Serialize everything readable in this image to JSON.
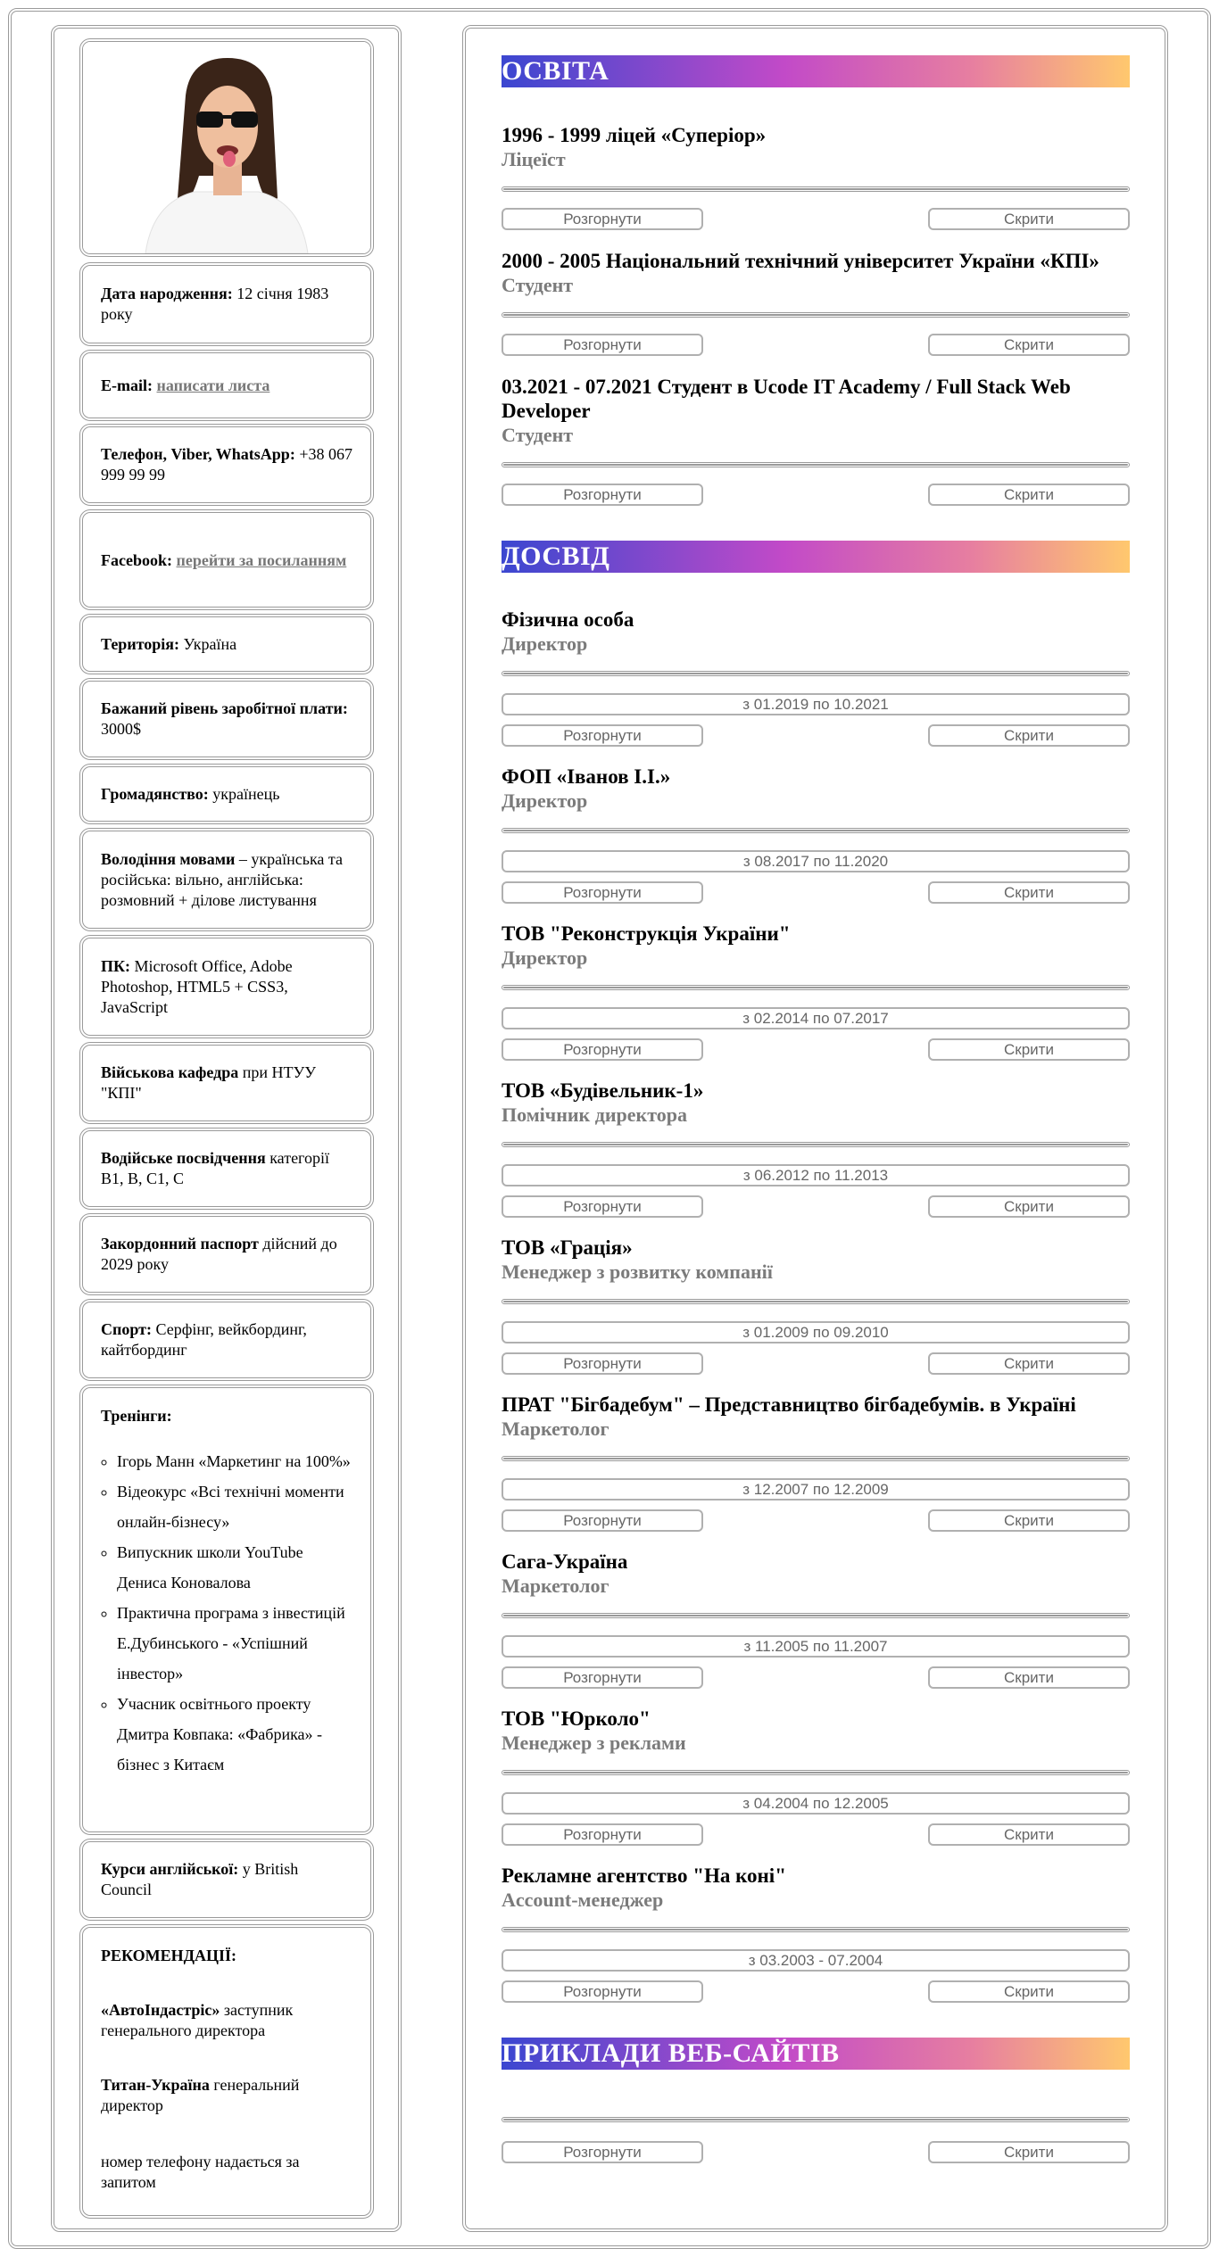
{
  "sidebar": {
    "birth": {
      "label": "Дата народження:",
      "value": " 12 січня 1983 року"
    },
    "email": {
      "label": "E-mail:",
      "link": "написати листа"
    },
    "phone": {
      "label": "Телефон, Viber, WhatsApp:",
      "value": " +38 067 999 99 99"
    },
    "facebook": {
      "label": "Facebook:",
      "link": "перейти за посиланням"
    },
    "territory": {
      "label": "Територія:",
      "value": " Україна"
    },
    "salary": {
      "label": "Бажаний рівень заробітної плати:",
      "value": " 3000$"
    },
    "citizenship": {
      "label": "Громадянство:",
      "value": " українець"
    },
    "languages": {
      "label": "Володіння мовами",
      "value": " – українська та російська: вільно, англійська: розмовний + ділове листування"
    },
    "pc": {
      "label": "ПК:",
      "value": " Microsoft Office, Adobe Photoshop, HTML5 + CSS3, JavaScript"
    },
    "military": {
      "label": "Військова кафедра",
      "value": " при НТУУ \"КПІ\""
    },
    "driver": {
      "label": "Водійське посвідчення",
      "value": " категорії B1, B, C1, C"
    },
    "passport": {
      "label": "Закордонний паспорт",
      "value": " дійсний до 2029 року"
    },
    "sport": {
      "label": "Спорт:",
      "value": " Серфінг, вейкбординг, кайтбординг"
    },
    "trainings": {
      "label": "Тренінги:",
      "items": [
        "Ігорь Манн «Маркетинг на 100%»",
        "Відеокурс «Всі технічні моменти онлайн-бізнесу»",
        "Випускник школи YouTube Дениса Коновалова",
        "Практична програма з інвестицій Е.Дубинського - «Успішний інвестор»",
        "Учасник освітнього проекту Дмитра Ковпака: «Фабрика» - бізнес з Китаєм"
      ]
    },
    "english": {
      "label": "Курси англійської:",
      "value": " у British Council"
    },
    "recommendations": {
      "label": "РЕКОМЕНДАЦІЇ:",
      "r1_company": "«АвтоІндастріс»",
      "r1_role": " заступник генерального директора",
      "r2_company": "Титан-Україна",
      "r2_role": " генеральний директор",
      "note": "номер телефону надається за запитом"
    }
  },
  "buttons": {
    "expand": "Розгорнути",
    "hide": "Скрити"
  },
  "education": {
    "heading": "ОСВІТА",
    "items": [
      {
        "title": "1996 - 1999 ліцей «Суперіор»",
        "role": "Ліцеїст"
      },
      {
        "title": "2000 - 2005 Національний технічний університет України «КПІ»",
        "role": "Студент"
      },
      {
        "title": "03.2021 - 07.2021 Студент в Ucode IT Academy / Full Stack Web Developer",
        "role": "Студент"
      }
    ]
  },
  "experience": {
    "heading": "ДОСВІД",
    "items": [
      {
        "title": "Фізична особа",
        "role": "Директор",
        "dates": "з 01.2019 по 10.2021"
      },
      {
        "title": "ФОП «Іванов І.І.»",
        "role": "Директор",
        "dates": "з 08.2017 по 11.2020"
      },
      {
        "title": "ТОВ \"Реконструкція України\"",
        "role": "Директор",
        "dates": "з 02.2014 по 07.2017"
      },
      {
        "title": "ТОВ «Будівельник-1»",
        "role": "Помічник директора",
        "dates": "з 06.2012 по 11.2013"
      },
      {
        "title": "ТОВ «Грація»",
        "role": "Менеджер з розвитку компанії",
        "dates": "з 01.2009 по 09.2010"
      },
      {
        "title": "ПРАТ \"Бігбадебум\" – Представництво бігбадебумів. в Україні",
        "role": "Маркетолог",
        "dates": "з 12.2007 по 12.2009"
      },
      {
        "title": "Сага-Україна",
        "role": "Маркетолог",
        "dates": "з 11.2005 по 11.2007"
      },
      {
        "title": "ТОВ \"Юрколо\"",
        "role": "Менеджер з реклами",
        "dates": "з 04.2004 по 12.2005"
      },
      {
        "title": "Рекламне агентство \"На коні\"",
        "role": "Account-менеджер",
        "dates": "з 03.2003 - 07.2004"
      }
    ]
  },
  "websites": {
    "heading": "ПРИКЛАДИ ВЕБ-САЙТІВ"
  }
}
